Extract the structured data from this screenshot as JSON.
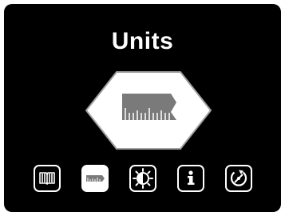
{
  "screen": {
    "title": "Units",
    "selected_menu": "units",
    "hero_icon": "ruler-icon"
  },
  "menu": {
    "items": [
      {
        "id": "manual",
        "icon": "open-book-icon",
        "active": false
      },
      {
        "id": "units",
        "icon": "ruler-icon",
        "active": true
      },
      {
        "id": "display",
        "icon": "contrast-icon",
        "active": false
      },
      {
        "id": "info",
        "icon": "info-icon",
        "active": false
      },
      {
        "id": "calibration",
        "icon": "calibration-icon",
        "active": false
      }
    ]
  },
  "colors": {
    "background": "#000000",
    "foreground": "#ffffff",
    "hero_fill": "#ffffff",
    "hero_ruler": "#7a7a7a"
  }
}
